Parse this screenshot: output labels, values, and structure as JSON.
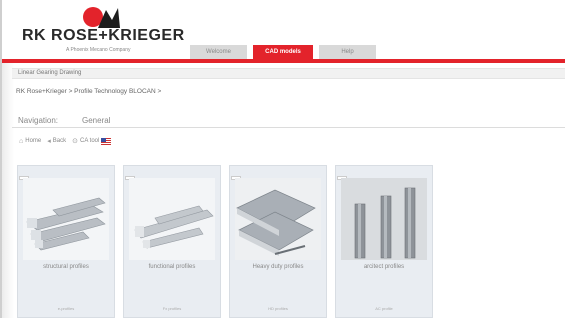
{
  "brand": {
    "name": "RK ROSE+KRIEGER",
    "tagline": "A Phoenix Mecano Company"
  },
  "tabs": [
    {
      "label": "Welcome",
      "active": false
    },
    {
      "label": "CAD models",
      "active": true
    },
    {
      "label": "Help",
      "active": false
    }
  ],
  "strip": {
    "text": "Linear Gearing Drawing"
  },
  "breadcrumb": {
    "text": "RK Rose+Krieger > Profile Technology BLOCAN >"
  },
  "navigation": {
    "label": "Navigation:",
    "value": "General"
  },
  "toolbar": {
    "home": "Home",
    "back": "Back",
    "cad": "CA tool"
  },
  "cards": [
    {
      "label": "structural profiles",
      "foot": "e-profiles"
    },
    {
      "label": "functional profiles",
      "foot": "Fx profiles"
    },
    {
      "label": "Heavy duty profiles",
      "foot": "HD profiles"
    },
    {
      "label": "arcitect profiles",
      "foot": "AC profile"
    }
  ],
  "colors": {
    "accent": "#e3232b",
    "card_bg": "#e9edf2"
  }
}
